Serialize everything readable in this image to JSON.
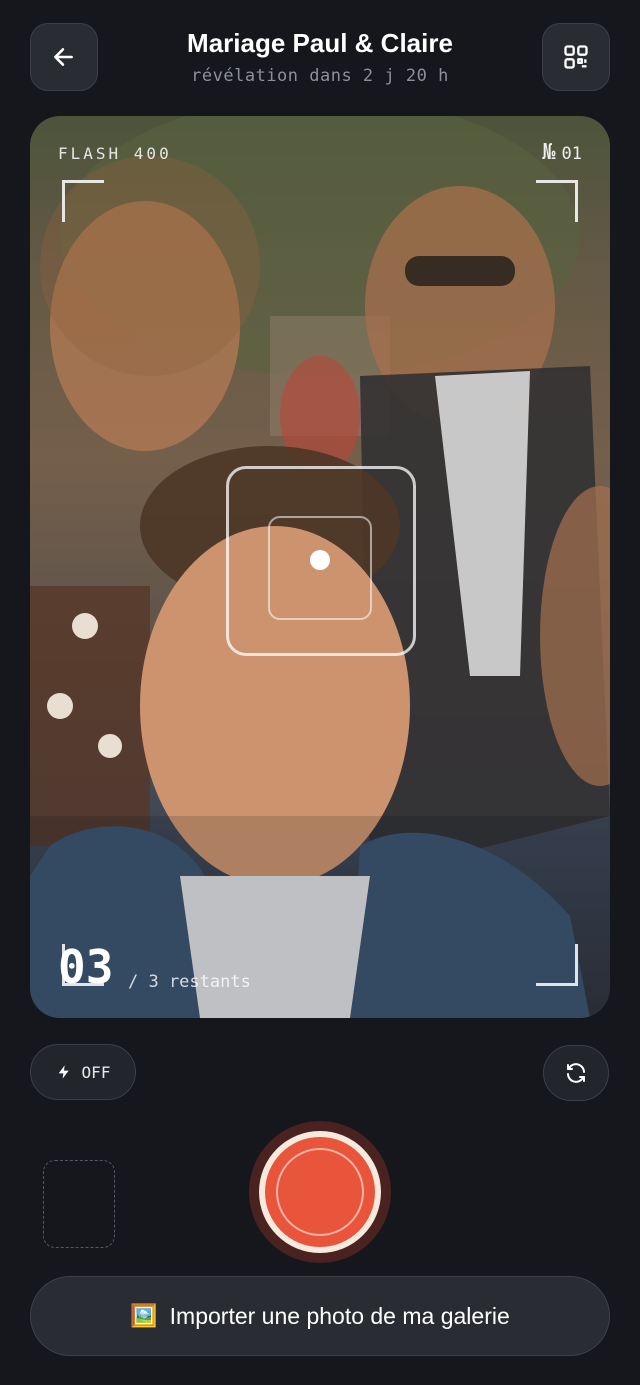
{
  "header": {
    "title": "Mariage Paul & Claire",
    "subtitle": "révélation dans 2 j 20 h"
  },
  "icons": {
    "back": "arrow-left-icon",
    "menu": "qr-code-icon",
    "flash": "lightning-icon",
    "flip": "refresh-camera-icon",
    "gallery": "framed-picture-emoji"
  },
  "viewfinder": {
    "film_label": "FLASH 400",
    "frame_symbol": "№",
    "frame_number": "01",
    "shots_count": "03",
    "shots_rest": "/ 3 restants"
  },
  "controls": {
    "flash_state": "OFF",
    "import_emoji": "🖼️",
    "import_label": "Importer une photo de ma galerie"
  },
  "colors": {
    "background": "#15171d",
    "shutter_accent": "#e8553a",
    "button_surface": "#2a2c33"
  }
}
